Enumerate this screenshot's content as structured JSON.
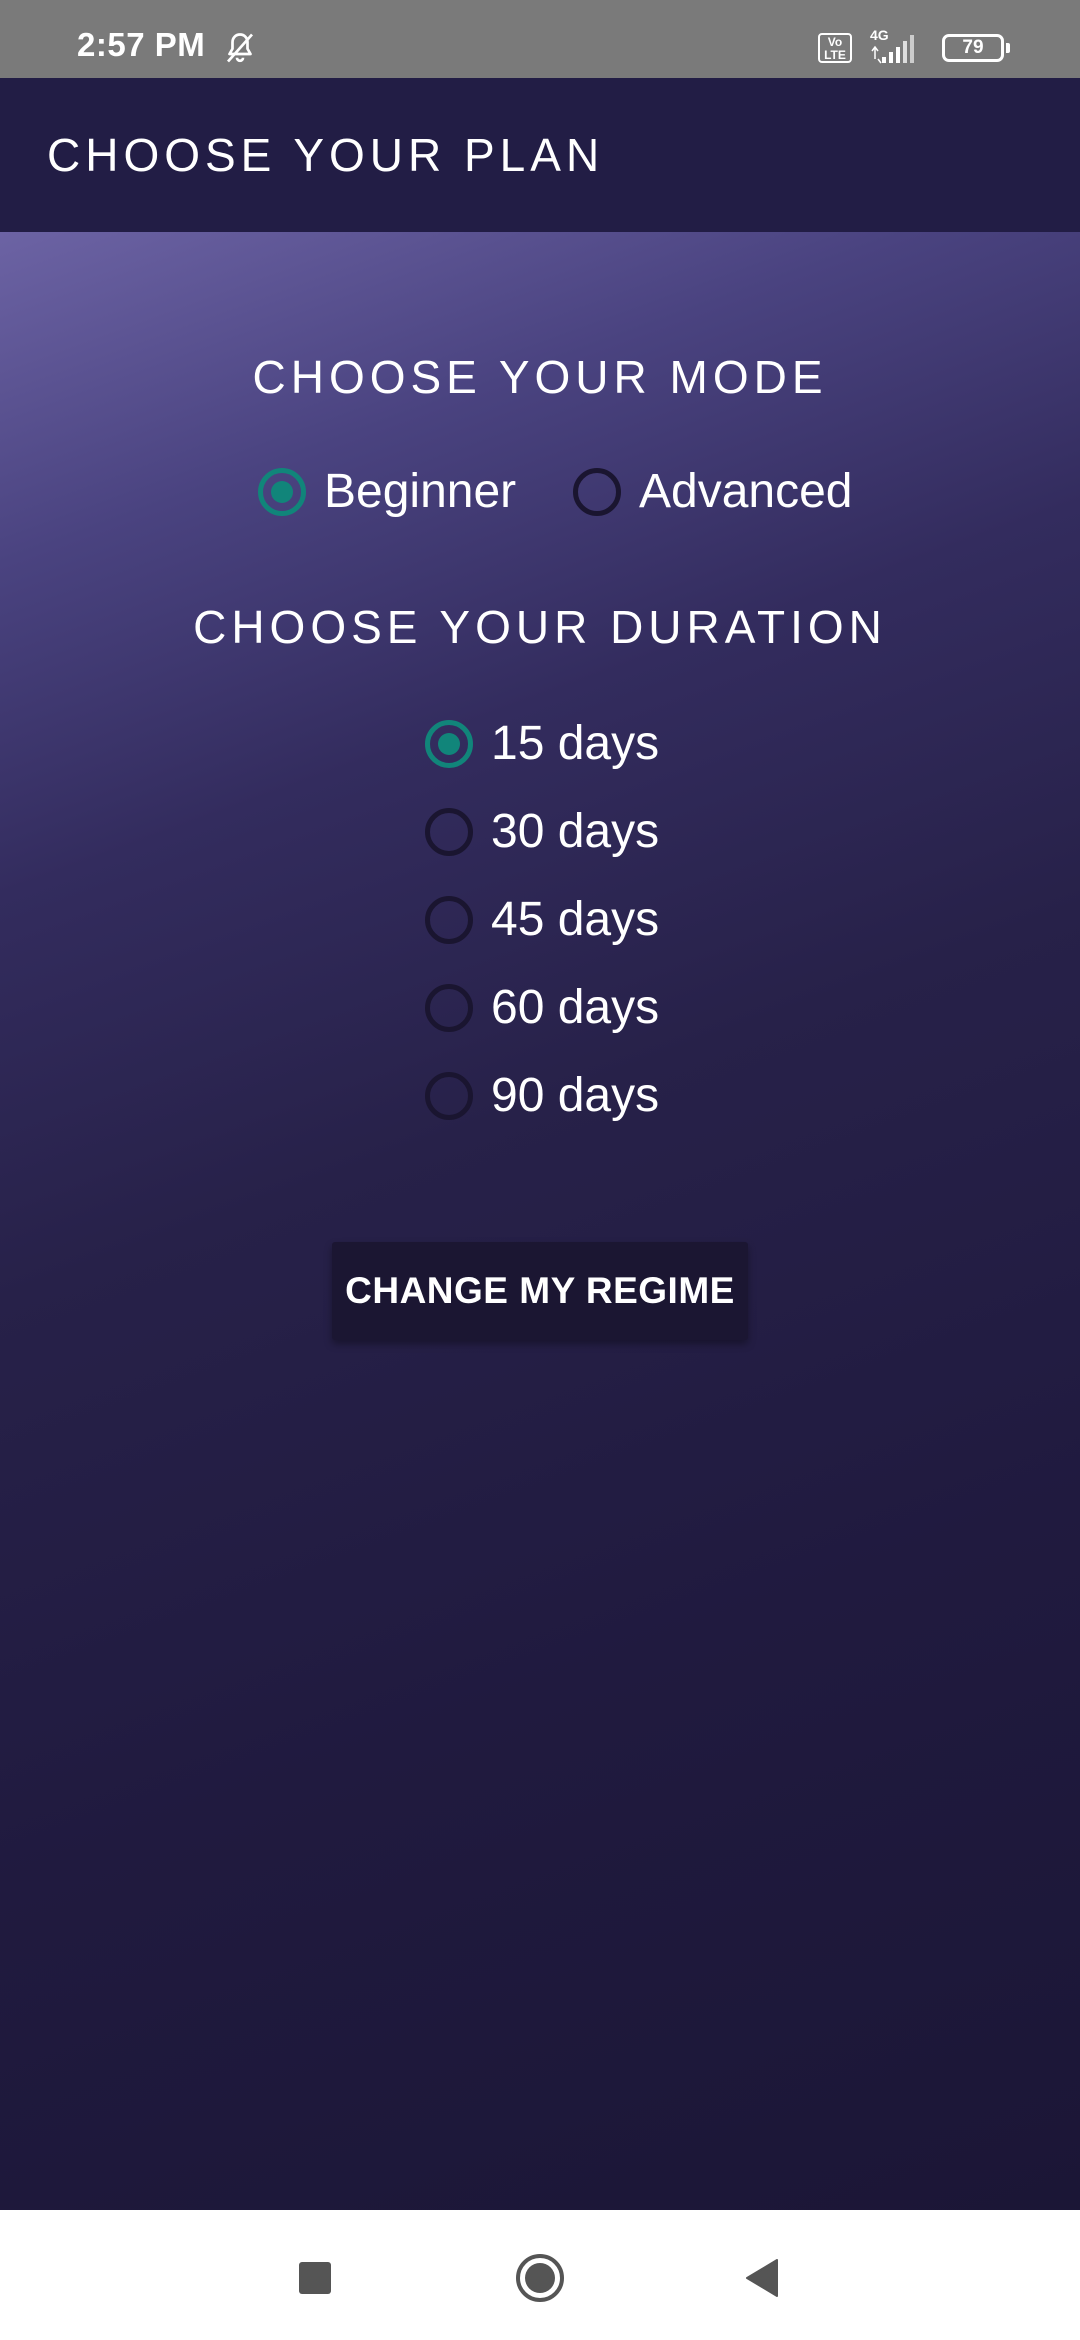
{
  "status_bar": {
    "time": "2:57 PM",
    "volte": "Vo LTE",
    "network": "4G",
    "battery": "79",
    "icons": [
      "bell-off-icon",
      "volte-icon",
      "signal-icon",
      "battery-icon"
    ]
  },
  "app_bar": {
    "title": "CHOOSE YOUR PLAN"
  },
  "mode": {
    "title": "CHOOSE YOUR MODE",
    "options": [
      {
        "label": "Beginner",
        "checked": true
      },
      {
        "label": "Advanced",
        "checked": false
      }
    ]
  },
  "duration": {
    "title": "CHOOSE YOUR DURATION",
    "options": [
      {
        "label": "15 days",
        "checked": true
      },
      {
        "label": "30 days",
        "checked": false
      },
      {
        "label": "45 days",
        "checked": false
      },
      {
        "label": "60 days",
        "checked": false
      },
      {
        "label": "90 days",
        "checked": false
      }
    ]
  },
  "button": {
    "label": "CHANGE MY REGIME"
  },
  "nav_bar": {
    "icons": [
      "recents-square-icon",
      "home-circle-icon",
      "back-triangle-icon"
    ]
  },
  "colors": {
    "app_bar": "#221d45",
    "accent": "#11857a",
    "button": "#1b1632",
    "status_bar": "#7a7a7a"
  }
}
